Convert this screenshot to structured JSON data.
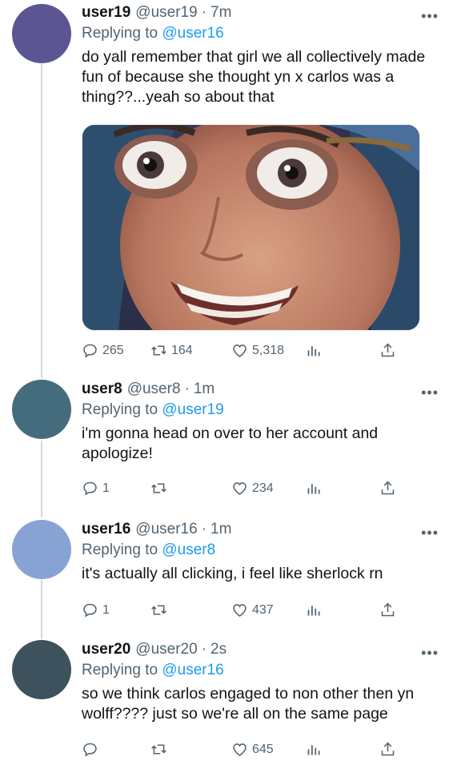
{
  "tweets": [
    {
      "name": "user19",
      "handle": "@user19",
      "time": "7m",
      "replying_prefix": "Replying to ",
      "replying_to": "@user16",
      "text": "do yall remember that girl we all collectively made fun of because she thought yn x carlos was a thing??...yeah so about that",
      "avatar_color": "#5b5593",
      "has_media": true,
      "stats": {
        "replies": "265",
        "retweets": "164",
        "likes": "5,318"
      }
    },
    {
      "name": "user8",
      "handle": "@user8",
      "time": "1m",
      "replying_prefix": "Replying to ",
      "replying_to": "@user19",
      "text": "i'm gonna head on over to her account and apologize!",
      "avatar_color": "#456c7d",
      "stats": {
        "replies": "1",
        "retweets": "",
        "likes": "234"
      }
    },
    {
      "name": "user16",
      "handle": "@user16",
      "time": "1m",
      "replying_prefix": "Replying to ",
      "replying_to": "@user8",
      "text": "it's actually all clicking, i feel like sherlock rn",
      "avatar_color": "#87a3d3",
      "stats": {
        "replies": "1",
        "retweets": "",
        "likes": "437"
      }
    },
    {
      "name": "user20",
      "handle": "@user20",
      "time": "2s",
      "replying_prefix": "Replying to ",
      "replying_to": "@user16",
      "text": "so we think carlos engaged to non other then yn wolff???? just so we're all on the same page",
      "avatar_color": "#3e525e",
      "stats": {
        "replies": "",
        "retweets": "",
        "likes": "645"
      }
    }
  ],
  "ui": {
    "dot": "·",
    "more": "•••"
  },
  "colors": {
    "accent": "#1d9bf0",
    "muted": "#536471",
    "thread_line": "#cfd9de"
  },
  "icons": [
    "reply-icon",
    "retweet-icon",
    "like-icon",
    "analytics-icon",
    "share-icon",
    "more-icon"
  ]
}
